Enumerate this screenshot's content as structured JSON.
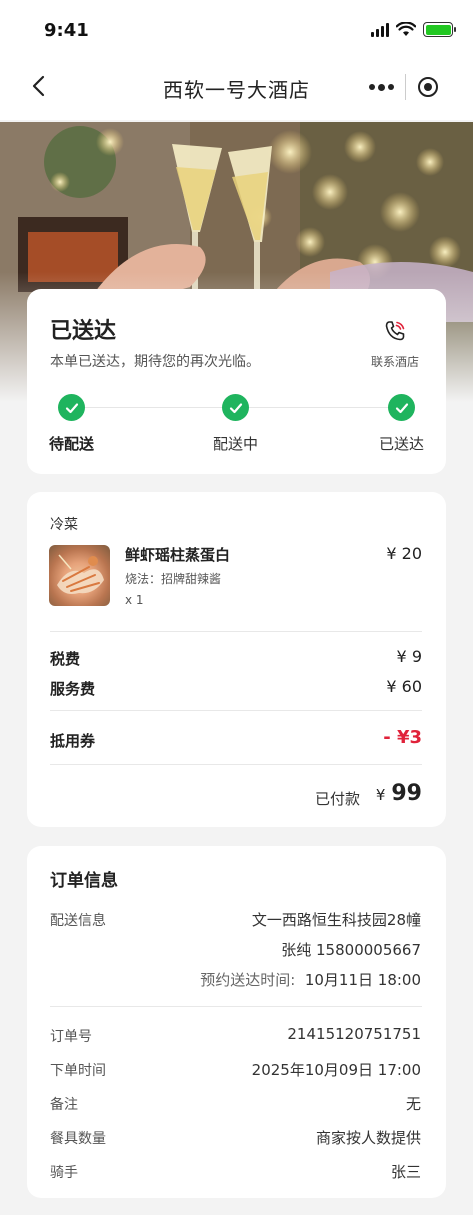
{
  "status_bar": {
    "time": "9:41"
  },
  "nav": {
    "title": "西软一号大酒店"
  },
  "delivery": {
    "title": "已送达",
    "subtitle": "本单已送达，期待您的再次光临。",
    "contact_label": "联系酒店",
    "steps": [
      {
        "label": "待配送"
      },
      {
        "label": "配送中"
      },
      {
        "label": "已送达"
      }
    ],
    "step_color": "#1fb45e"
  },
  "order": {
    "category": "冷菜",
    "item": {
      "name": "鲜虾瑶柱蒸蛋白",
      "option": "烧法：招牌甜辣酱",
      "qty": "x 1",
      "price": "¥ 20"
    },
    "tax_label": "税费",
    "tax_value": "¥ 9",
    "service_label": "服务费",
    "service_value": "¥ 60",
    "coupon_label": "抵用券",
    "coupon_value": "- ¥3",
    "paid_label": "已付款",
    "paid_symbol": "¥",
    "paid_amount": "99",
    "accent_color": "#e0223a"
  },
  "info": {
    "title": "订单信息",
    "delivery_label": "配送信息",
    "address": "文一西路恒生科技园28幢",
    "contact": "张纯   15800005667",
    "scheduled_label": "预约送达时间:",
    "scheduled_time": "10月11日   18:00",
    "rows": [
      {
        "label": "订单号",
        "value": "21415120751751"
      },
      {
        "label": "下单时间",
        "value": "2025年10月09日   17:00"
      },
      {
        "label": "备注",
        "value": "无"
      },
      {
        "label": "餐具数量",
        "value": "商家按人数提供"
      },
      {
        "label": "骑手",
        "value": "张三"
      }
    ]
  }
}
